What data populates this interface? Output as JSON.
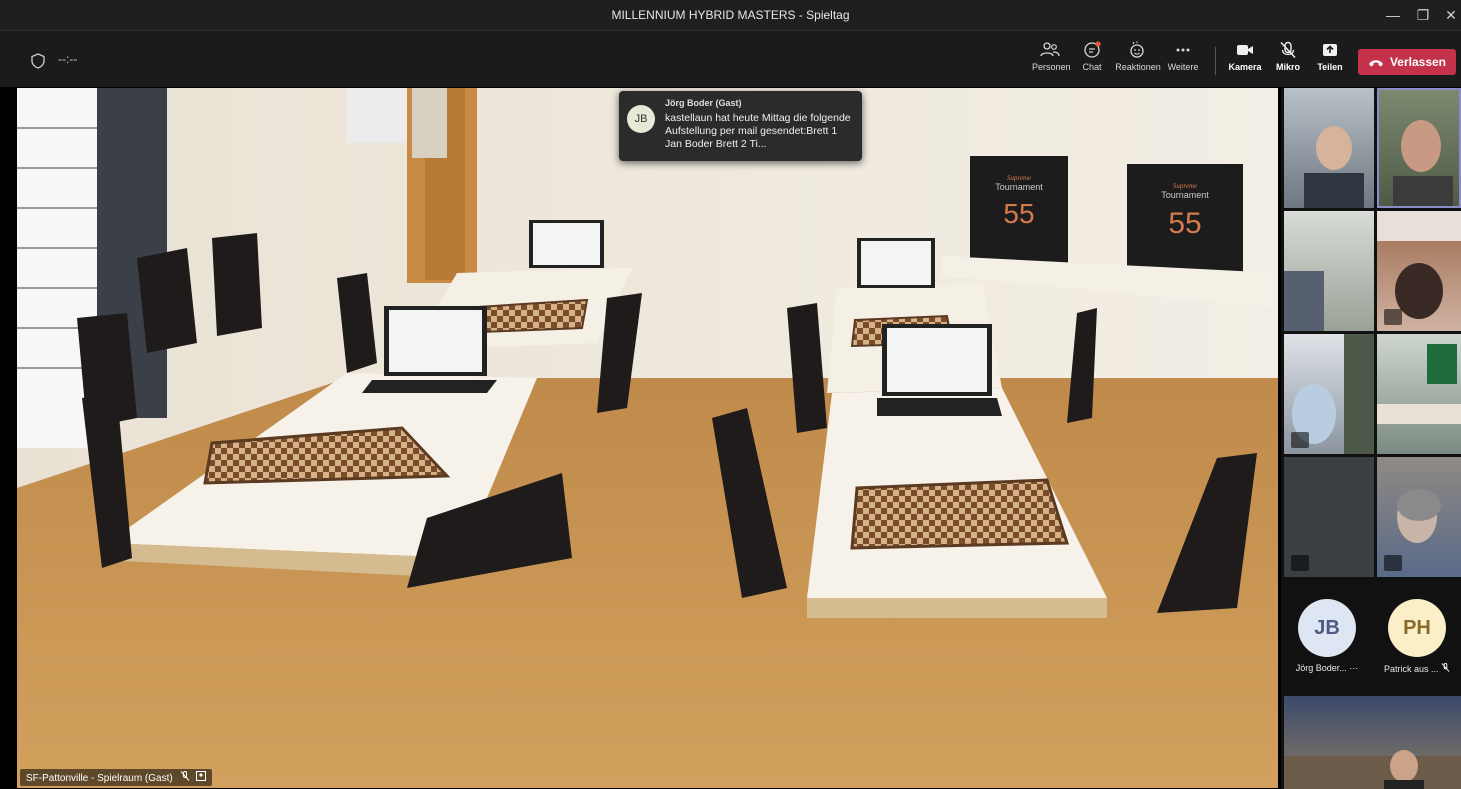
{
  "window": {
    "title": "MILLENNIUM HYBRID MASTERS - Spieltag",
    "timer": "--:--"
  },
  "toolbar": {
    "people_label": "Personen",
    "chat_label": "Chat",
    "reactions_label": "Reaktionen",
    "more_label": "Weitere",
    "camera_label": "Kamera",
    "mic_label": "Mikro",
    "share_label": "Teilen",
    "leave_label": "Verlassen"
  },
  "toast": {
    "initials": "JB",
    "sender": "Jörg Boder (Gast)",
    "message": "kastellaun hat heute Mittag die folgende Aufstellung per mail gesendet:Brett 1 Jan Boder Brett 2 Ti..."
  },
  "main_video": {
    "caption": "SF-Pattonville - Spielraum (Gast)",
    "scene": {
      "box_label": "Tournament",
      "box_number": "55",
      "box_brand": "Supreme"
    }
  },
  "gallery": {
    "avatars": [
      {
        "initials": "JB",
        "name": "Jörg Boder...",
        "color": "#dfe6f3",
        "extra": "···"
      },
      {
        "initials": "PH",
        "name": "Patrick aus ...",
        "color": "#fbefc8",
        "extra": ""
      }
    ]
  },
  "colors": {
    "leave": "#c4314b",
    "toolbar": "#1b1b1b",
    "active_speaker": "#8b8cc7"
  }
}
